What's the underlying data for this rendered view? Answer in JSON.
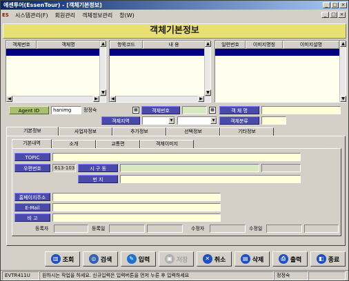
{
  "window": {
    "title": "에센투어(EssenTour) - [객체기본정보]",
    "buttons": {
      "minimize": "_",
      "maximize": "□",
      "close": "×"
    }
  },
  "menu": {
    "logo": "ES",
    "items": [
      "시스템관리(F)",
      "회원관리",
      "객체정보관리",
      "창(W)"
    ]
  },
  "header": {
    "title": "객체기본정보"
  },
  "grids": {
    "object": {
      "columns": [
        "객체번호",
        "객체명"
      ]
    },
    "item": {
      "columns": [
        "항목코드",
        "내  용"
      ]
    },
    "image": {
      "columns": [
        "일련번호",
        "이미지명칭",
        "이미지설명"
      ]
    }
  },
  "agent": {
    "label": "Agent ID",
    "id": "hanimg",
    "name": "정정숙",
    "object_no_label": "객체번호",
    "object_no": "",
    "object_name_label": "객 체 명",
    "object_name": "",
    "region_label": "객체지역",
    "region1": "",
    "region2": "",
    "category_label": "객체분류",
    "category": ""
  },
  "main_tabs": [
    "기본정보",
    "사업자정보",
    "추가정보",
    "선택정보",
    "기타정보"
  ],
  "sub_tabs": [
    "기본내역",
    "소개",
    "교통편",
    "객체이미지"
  ],
  "form": {
    "topic_label": "TOPIC",
    "topic": "",
    "zip_label": "우편번호",
    "zip": "613-103",
    "city_label": "시 구 동",
    "city": "",
    "city_extra": "",
    "street_label": "번      지",
    "street": "",
    "homepage_label": "홈페이지주소",
    "homepage": "",
    "email_label": "E-Mail",
    "email": "",
    "note_label": "비     고",
    "note": "",
    "reg_user_label": "등록자",
    "reg_user": "",
    "reg_date_label": "등록일",
    "reg_date": "",
    "mod_user_label": "수정자",
    "mod_user": "",
    "mod_date_label": "수정일",
    "mod_date": ""
  },
  "toolbar": {
    "query": "조회",
    "search": "검색",
    "insert": "입력",
    "save": "저장",
    "cancel": "취소",
    "delete": "삭제",
    "print": "출력",
    "close": "종료"
  },
  "status": {
    "form_id": "EVTR411U",
    "message": "원하시는 작업을 하세요. 신규입력은 입력버튼을 먼저 누른 후 입력하세요",
    "user": "정정숙"
  },
  "colors": {
    "title_start": "#0a246a",
    "header_bg": "#e8e070",
    "label_blue": "#4a4aaa",
    "label_green": "#a8c070",
    "selection": "#000080"
  }
}
